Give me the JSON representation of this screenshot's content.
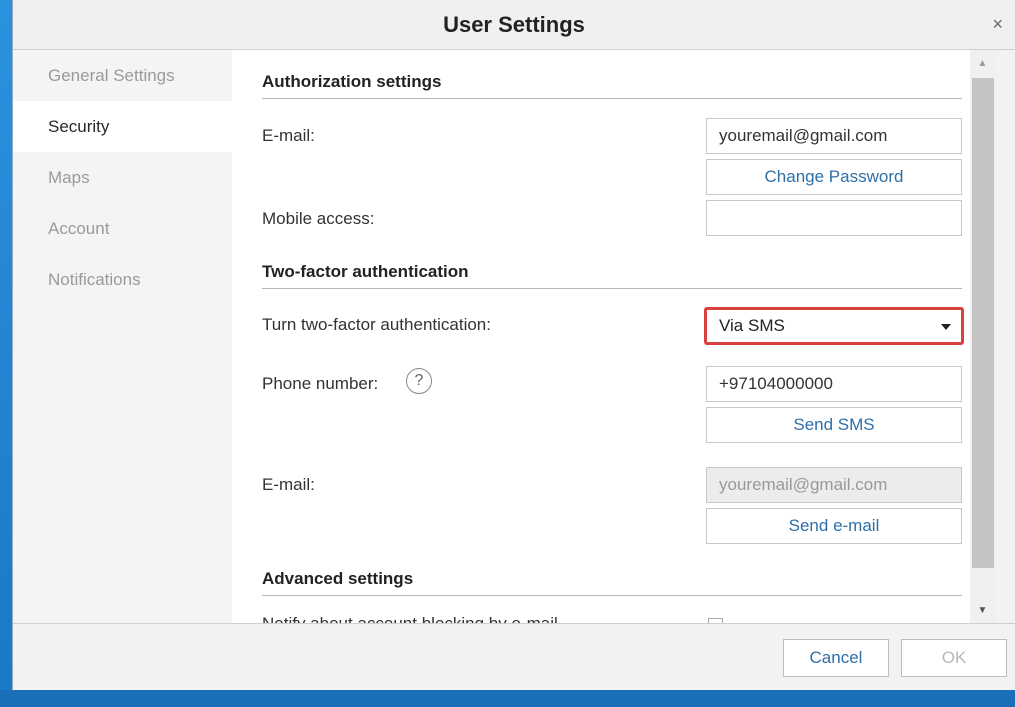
{
  "dialog": {
    "title": "User Settings",
    "close_glyph": "×"
  },
  "sidebar": {
    "items": [
      {
        "label": "General Settings",
        "active": false
      },
      {
        "label": "Security",
        "active": true
      },
      {
        "label": "Maps",
        "active": false
      },
      {
        "label": "Account",
        "active": false
      },
      {
        "label": "Notifications",
        "active": false
      }
    ]
  },
  "authorization": {
    "heading": "Authorization settings",
    "email_label": "E-mail:",
    "email_value": "youremail@gmail.com",
    "change_password_label": "Change Password",
    "mobile_access_label": "Mobile access:",
    "mobile_access_value": ""
  },
  "two_factor": {
    "heading": "Two-factor authentication",
    "turn_label": "Turn two-factor authentication:",
    "method_selected": "Via SMS",
    "phone_label": "Phone number:",
    "help_glyph": "?",
    "phone_value": "+97104000000",
    "send_sms_label": "Send SMS",
    "email_label": "E-mail:",
    "email_value": "youremail@gmail.com",
    "send_email_label": "Send e-mail"
  },
  "advanced": {
    "heading": "Advanced settings",
    "notify_label": "Notify about account blocking by e-mail"
  },
  "footer": {
    "cancel_label": "Cancel",
    "ok_label": "OK"
  },
  "colors": {
    "highlight_border": "#d9413f",
    "link_text": "#2f6fa8"
  }
}
